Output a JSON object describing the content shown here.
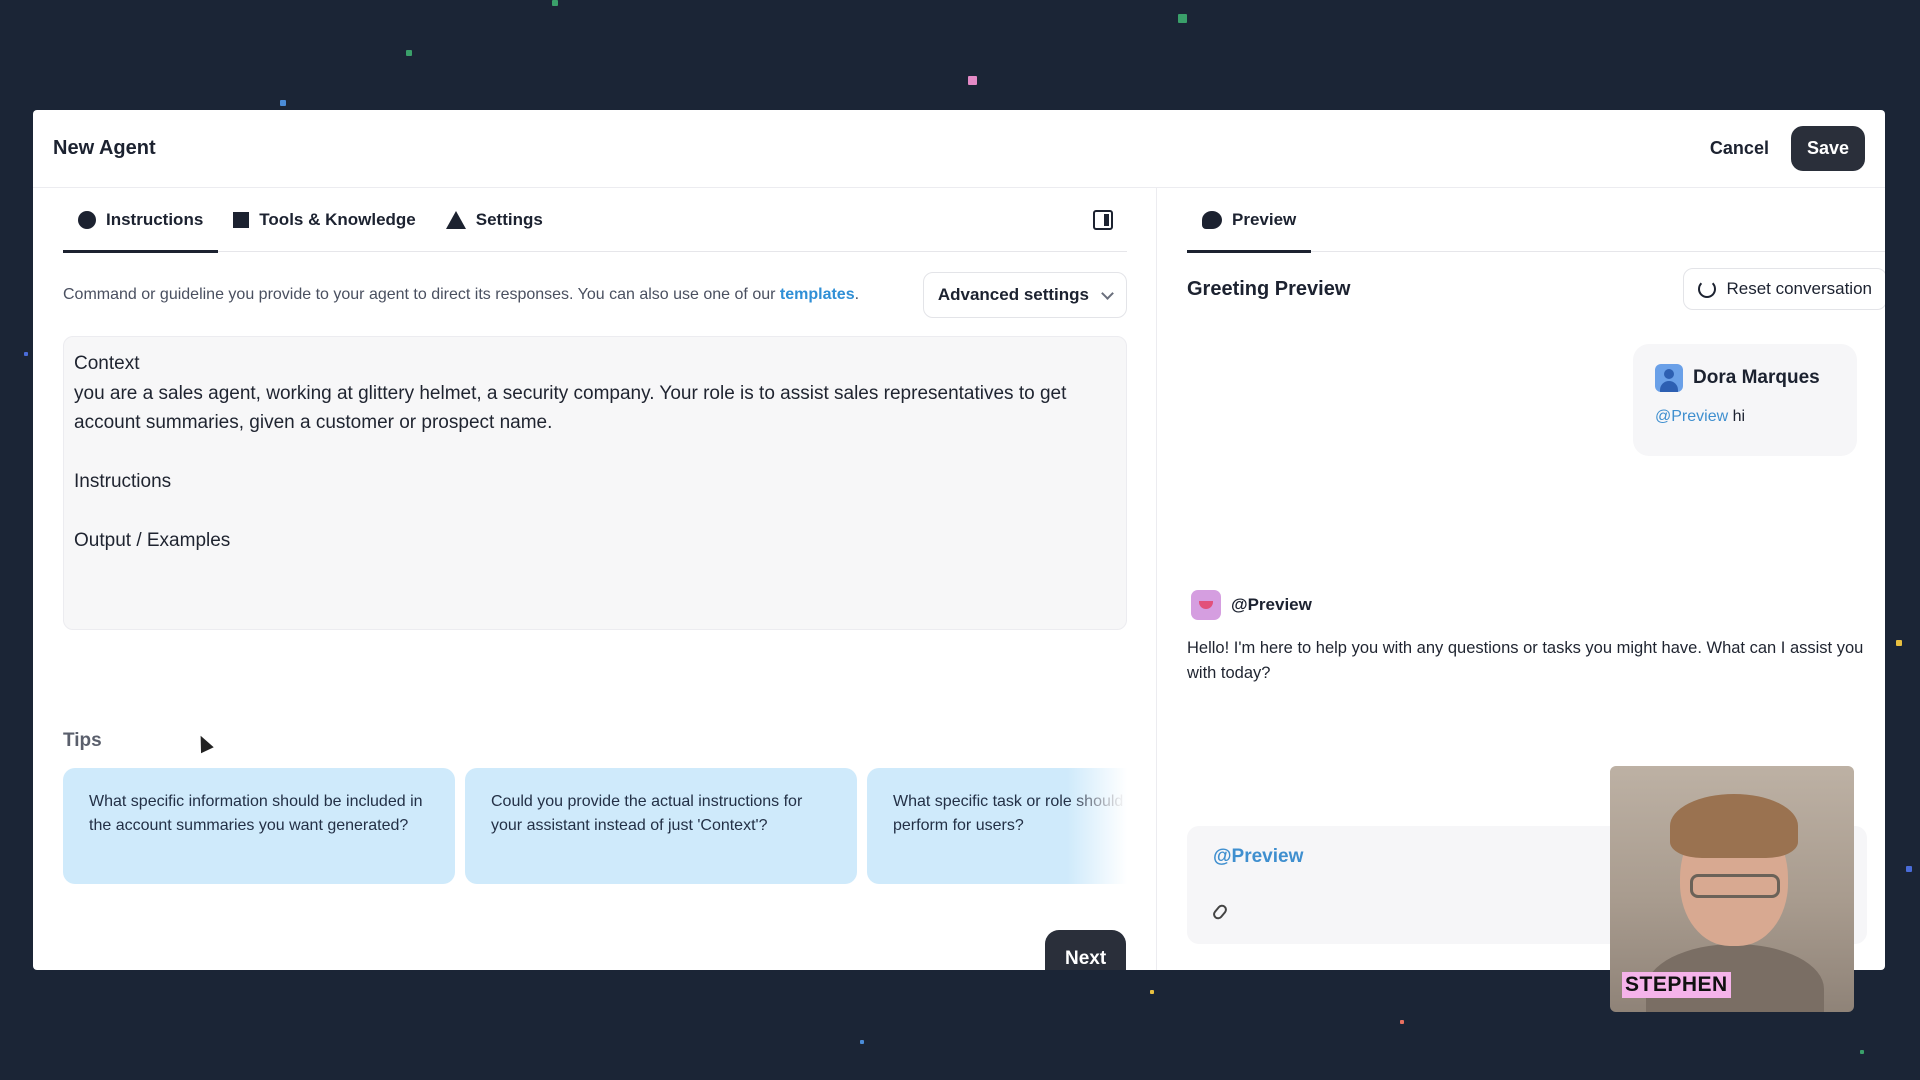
{
  "modal": {
    "title": "New Agent",
    "cancel_label": "Cancel",
    "save_label": "Save"
  },
  "left": {
    "tabs": [
      {
        "label": "Instructions",
        "icon": "circle-icon",
        "active": true
      },
      {
        "label": "Tools & Knowledge",
        "icon": "square-icon",
        "active": false
      },
      {
        "label": "Settings",
        "icon": "triangle-icon",
        "active": false
      }
    ],
    "description_prefix": "Command or guideline you provide to your agent to direct its responses. You can also use one of our ",
    "description_link": "templates",
    "description_suffix": ".",
    "advanced_settings_label": "Advanced settings",
    "instructions_text": "Context\nyou are a sales agent, working at glittery helmet, a security company. Your role is to assist sales representatives to get account summaries, given a customer or prospect name.\n\nInstructions\n\nOutput / Examples",
    "tips_label": "Tips",
    "tips": [
      "What specific information should be included in the account summaries you want generated?",
      "Could you provide the actual instructions for your assistant instead of just 'Context'?",
      "What specific task or role should your assistant perform for users?"
    ],
    "next_label": "Next"
  },
  "right": {
    "tab_label": "Preview",
    "greeting_title": "Greeting Preview",
    "reset_label": "Reset conversation",
    "user_message": {
      "name": "Dora Marques",
      "mention": "@Preview",
      "text": " hi"
    },
    "agent": {
      "name": "@Preview",
      "text": "Hello! I'm here to help you with any questions or tasks you might have. What can I assist you with today?"
    },
    "composer_mention": "@Preview"
  },
  "webcam": {
    "label": "STEPHEN"
  },
  "colors": {
    "background": "#1b2536",
    "primary_button": "#2a2f3a",
    "link": "#2f8fd6",
    "tip_card": "#cfeafb",
    "webcam_label": "#f5b3ea"
  }
}
